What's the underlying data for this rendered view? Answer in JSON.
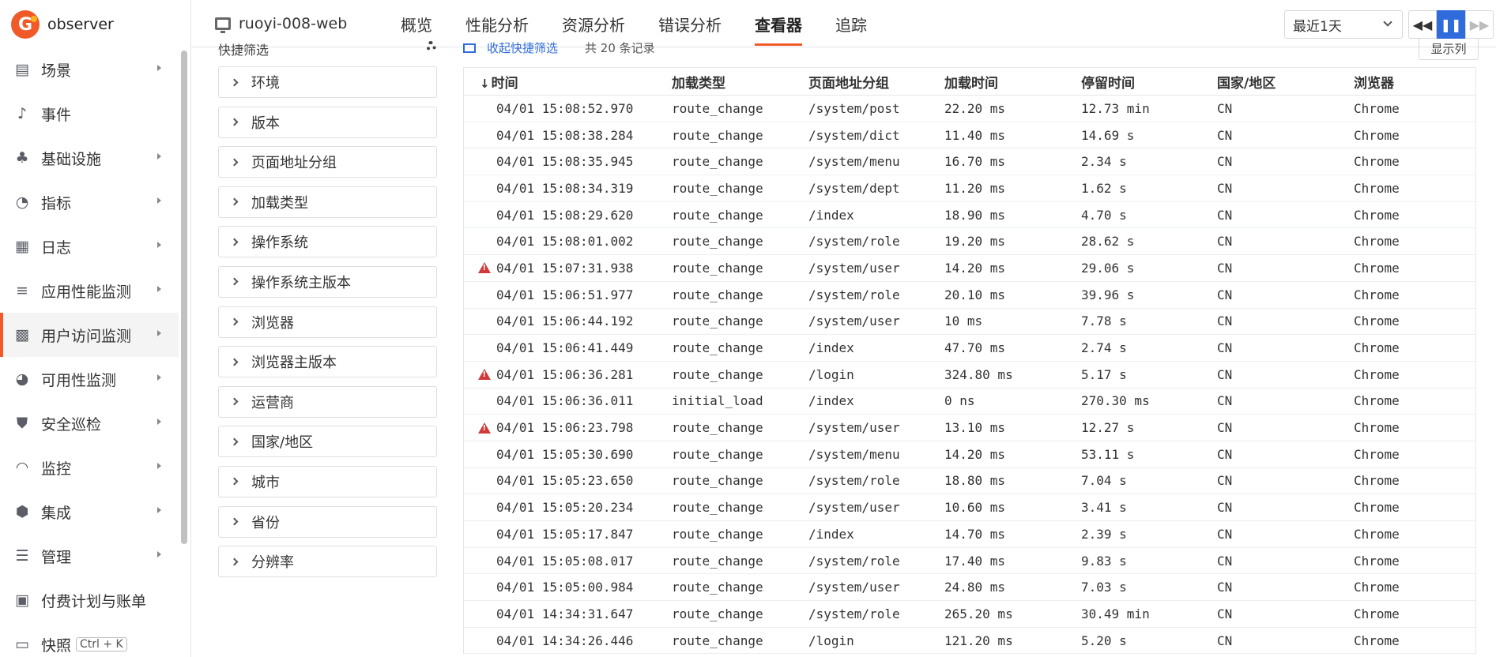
{
  "app": {
    "brand": "observer",
    "brand_color": "#f05a28",
    "accent": "#2f6bdb"
  },
  "sidebar": {
    "items": [
      {
        "icon": "layers-icon",
        "label": "场景",
        "expandable": true
      },
      {
        "icon": "bell-icon",
        "label": "事件",
        "expandable": false
      },
      {
        "icon": "cubes-icon",
        "label": "基础设施",
        "expandable": true
      },
      {
        "icon": "gauge-icon",
        "label": "指标",
        "expandable": true
      },
      {
        "icon": "calendar-icon",
        "label": "日志",
        "expandable": true
      },
      {
        "icon": "bars-icon",
        "label": "应用性能监测",
        "expandable": true
      },
      {
        "icon": "apps-icon",
        "label": "用户访问监测",
        "expandable": true,
        "active": true
      },
      {
        "icon": "satellite-icon",
        "label": "可用性监测",
        "expandable": true
      },
      {
        "icon": "shield-icon",
        "label": "安全巡检",
        "expandable": true
      },
      {
        "icon": "radar-icon",
        "label": "监控",
        "expandable": true
      },
      {
        "icon": "box-icon",
        "label": "集成",
        "expandable": true
      },
      {
        "icon": "sliders-icon",
        "label": "管理",
        "expandable": true
      },
      {
        "icon": "bill-icon",
        "label": "付费计划与账单",
        "expandable": false
      },
      {
        "icon": "camera-icon",
        "label": "快照",
        "shortcut": "Ctrl + K",
        "expandable": false
      }
    ]
  },
  "topbar": {
    "app_name": "ruoyi-008-web",
    "tabs": [
      "概览",
      "性能分析",
      "资源分析",
      "错误分析",
      "查看器",
      "追踪"
    ],
    "active_tab": "查看器",
    "time_range": "最近1天"
  },
  "filters": {
    "title": "快捷筛选",
    "facets": [
      "环境",
      "版本",
      "页面地址分组",
      "加载类型",
      "操作系统",
      "操作系统主版本",
      "浏览器",
      "浏览器主版本",
      "运营商",
      "国家/地区",
      "城市",
      "省份",
      "分辨率"
    ]
  },
  "list": {
    "favorite_label": "收起快捷筛选",
    "count_label": "共 20 条记录",
    "columns_button": "显示列",
    "headers": [
      "时间",
      "加载类型",
      "页面地址分组",
      "加载时间",
      "停留时间",
      "国家/地区",
      "浏览器"
    ],
    "rows": [
      {
        "warn": false,
        "time": "04/01 15:08:52.970",
        "type": "route_change",
        "page": "/system/post",
        "load": "22.20 ms",
        "stay": "12.73 min",
        "country": "CN",
        "browser": "Chrome"
      },
      {
        "warn": false,
        "time": "04/01 15:08:38.284",
        "type": "route_change",
        "page": "/system/dict",
        "load": "11.40 ms",
        "stay": "14.69 s",
        "country": "CN",
        "browser": "Chrome"
      },
      {
        "warn": false,
        "time": "04/01 15:08:35.945",
        "type": "route_change",
        "page": "/system/menu",
        "load": "16.70 ms",
        "stay": "2.34 s",
        "country": "CN",
        "browser": "Chrome"
      },
      {
        "warn": false,
        "time": "04/01 15:08:34.319",
        "type": "route_change",
        "page": "/system/dept",
        "load": "11.20 ms",
        "stay": "1.62 s",
        "country": "CN",
        "browser": "Chrome"
      },
      {
        "warn": false,
        "time": "04/01 15:08:29.620",
        "type": "route_change",
        "page": "/index",
        "load": "18.90 ms",
        "stay": "4.70 s",
        "country": "CN",
        "browser": "Chrome"
      },
      {
        "warn": false,
        "time": "04/01 15:08:01.002",
        "type": "route_change",
        "page": "/system/role",
        "load": "19.20 ms",
        "stay": "28.62 s",
        "country": "CN",
        "browser": "Chrome"
      },
      {
        "warn": true,
        "time": "04/01 15:07:31.938",
        "type": "route_change",
        "page": "/system/user",
        "load": "14.20 ms",
        "stay": "29.06 s",
        "country": "CN",
        "browser": "Chrome"
      },
      {
        "warn": false,
        "time": "04/01 15:06:51.977",
        "type": "route_change",
        "page": "/system/role",
        "load": "20.10 ms",
        "stay": "39.96 s",
        "country": "CN",
        "browser": "Chrome"
      },
      {
        "warn": false,
        "time": "04/01 15:06:44.192",
        "type": "route_change",
        "page": "/system/user",
        "load": "10 ms",
        "stay": "7.78 s",
        "country": "CN",
        "browser": "Chrome"
      },
      {
        "warn": false,
        "time": "04/01 15:06:41.449",
        "type": "route_change",
        "page": "/index",
        "load": "47.70 ms",
        "stay": "2.74 s",
        "country": "CN",
        "browser": "Chrome"
      },
      {
        "warn": true,
        "time": "04/01 15:06:36.281",
        "type": "route_change",
        "page": "/login",
        "load": "324.80 ms",
        "stay": "5.17 s",
        "country": "CN",
        "browser": "Chrome"
      },
      {
        "warn": false,
        "time": "04/01 15:06:36.011",
        "type": "initial_load",
        "page": "/index",
        "load": "0 ns",
        "stay": "270.30 ms",
        "country": "CN",
        "browser": "Chrome"
      },
      {
        "warn": true,
        "time": "04/01 15:06:23.798",
        "type": "route_change",
        "page": "/system/user",
        "load": "13.10 ms",
        "stay": "12.27 s",
        "country": "CN",
        "browser": "Chrome"
      },
      {
        "warn": false,
        "time": "04/01 15:05:30.690",
        "type": "route_change",
        "page": "/system/menu",
        "load": "14.20 ms",
        "stay": "53.11 s",
        "country": "CN",
        "browser": "Chrome"
      },
      {
        "warn": false,
        "time": "04/01 15:05:23.650",
        "type": "route_change",
        "page": "/system/role",
        "load": "18.80 ms",
        "stay": "7.04 s",
        "country": "CN",
        "browser": "Chrome"
      },
      {
        "warn": false,
        "time": "04/01 15:05:20.234",
        "type": "route_change",
        "page": "/system/user",
        "load": "10.60 ms",
        "stay": "3.41 s",
        "country": "CN",
        "browser": "Chrome"
      },
      {
        "warn": false,
        "time": "04/01 15:05:17.847",
        "type": "route_change",
        "page": "/index",
        "load": "14.70 ms",
        "stay": "2.39 s",
        "country": "CN",
        "browser": "Chrome"
      },
      {
        "warn": false,
        "time": "04/01 15:05:08.017",
        "type": "route_change",
        "page": "/system/role",
        "load": "17.40 ms",
        "stay": "9.83 s",
        "country": "CN",
        "browser": "Chrome"
      },
      {
        "warn": false,
        "time": "04/01 15:05:00.984",
        "type": "route_change",
        "page": "/system/user",
        "load": "24.80 ms",
        "stay": "7.03 s",
        "country": "CN",
        "browser": "Chrome"
      },
      {
        "warn": false,
        "time": "04/01 14:34:31.647",
        "type": "route_change",
        "page": "/system/role",
        "load": "265.20 ms",
        "stay": "30.49 min",
        "country": "CN",
        "browser": "Chrome"
      },
      {
        "warn": false,
        "time": "04/01 14:34:26.446",
        "type": "route_change",
        "page": "/login",
        "load": "121.20 ms",
        "stay": "5.20 s",
        "country": "CN",
        "browser": "Chrome"
      }
    ]
  }
}
